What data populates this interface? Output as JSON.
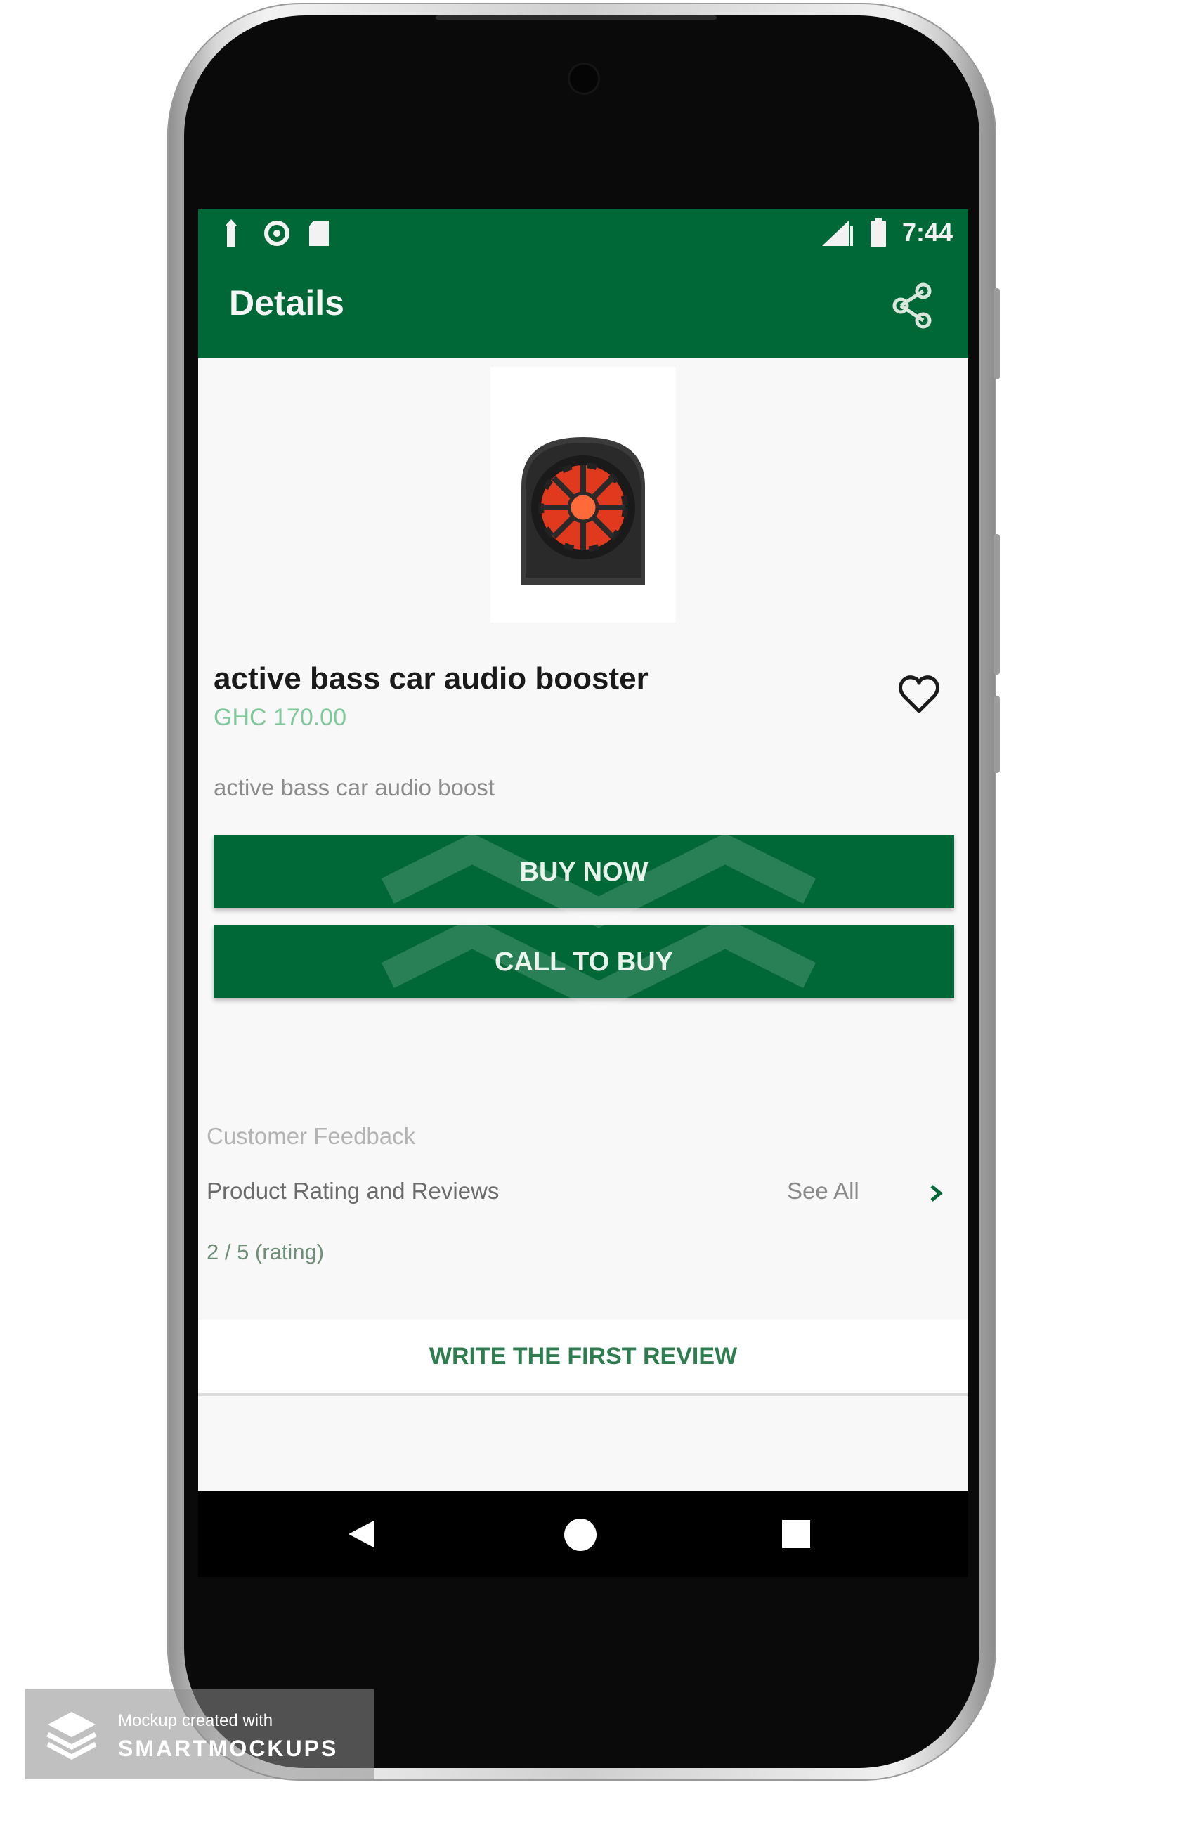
{
  "status_bar": {
    "time": "7:44",
    "left_icons": [
      "usb-icon",
      "sync-icon",
      "sd-card-icon"
    ],
    "right_icons": [
      "signal-icon",
      "battery-icon"
    ]
  },
  "app_bar": {
    "title": "Details",
    "share_icon": "share-icon"
  },
  "product": {
    "name": "active bass car audio booster",
    "price": "GHC 170.00",
    "description": "active bass car audio boost",
    "favorite_icon": "heart-outline-icon"
  },
  "actions": {
    "buy_now": "BUY NOW",
    "call_to_buy": "CALL TO BUY"
  },
  "feedback": {
    "section_title": "Customer Feedback",
    "row_label": "Product Rating and Reviews",
    "see_all": "See All",
    "chevron_icon": "chevron-right-icon",
    "rating": "2 / 5 (rating)",
    "write_review": "WRITE THE FIRST REVIEW"
  },
  "nav_bar": {
    "back_icon": "back-triangle-icon",
    "home_icon": "home-circle-icon",
    "recents_icon": "recents-square-icon"
  },
  "watermark": {
    "line1": "Mockup created with",
    "line2": "SMARTMOCKUPS"
  },
  "colors": {
    "brand_green": "#006837",
    "price_green": "#7ec99a",
    "screen_bg": "#f8f8f8"
  }
}
